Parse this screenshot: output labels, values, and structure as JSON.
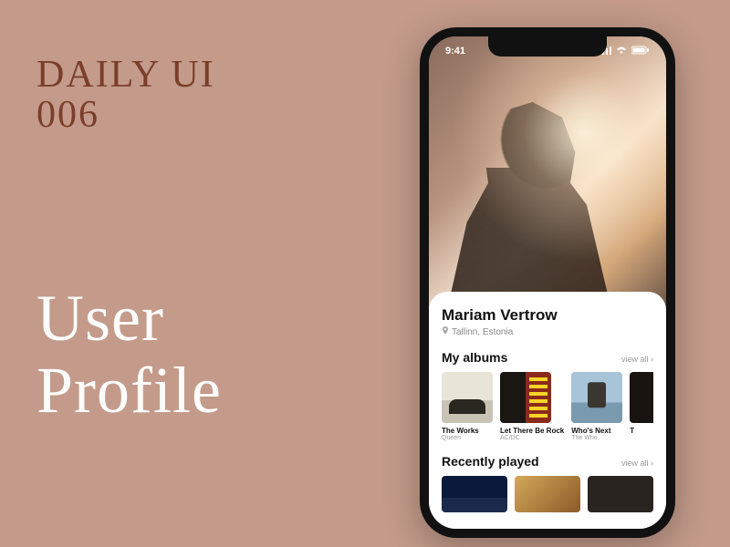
{
  "canvas": {
    "daily_ui_line1": "DAILY UI",
    "daily_ui_line2": "006",
    "title_line1": "User",
    "title_line2": "Profile"
  },
  "status": {
    "time": "9:41",
    "signal_icon": "cellular-icon",
    "wifi_icon": "wifi-icon",
    "battery_icon": "battery-icon"
  },
  "profile": {
    "name": "Mariam Vertrow",
    "location": "Tallinn, Estonia"
  },
  "albums_section": {
    "title": "My albums",
    "view_all": "view all ›",
    "items": [
      {
        "title": "The Works",
        "artist": "Queen"
      },
      {
        "title": "Let There Be Rock",
        "artist": "AC/DC"
      },
      {
        "title": "Who's Next",
        "artist": "The Who"
      },
      {
        "title": "T",
        "artist": ""
      }
    ]
  },
  "recent_section": {
    "title": "Recently played",
    "view_all": "view all ›"
  }
}
